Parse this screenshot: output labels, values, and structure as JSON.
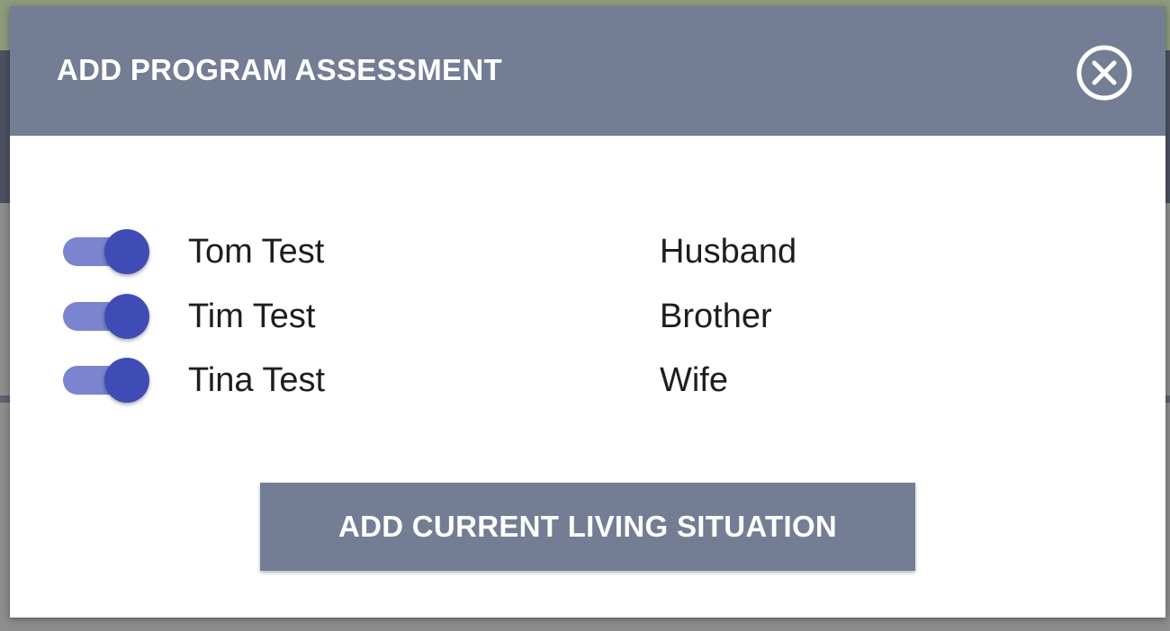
{
  "modal": {
    "title": "ADD PROGRAM ASSESSMENT",
    "close_icon": "close-circle-icon"
  },
  "members": [
    {
      "name": "Tom Test",
      "relation": "Husband",
      "enabled": true
    },
    {
      "name": "Tim Test",
      "relation": "Brother",
      "enabled": true
    },
    {
      "name": "Tina Test",
      "relation": "Wife",
      "enabled": true
    }
  ],
  "actions": {
    "add_label": "ADD CURRENT LIVING SITUATION"
  },
  "colors": {
    "header": "#737e95",
    "toggle_thumb": "#3f4cb5",
    "toggle_track": "#7a84cf"
  }
}
